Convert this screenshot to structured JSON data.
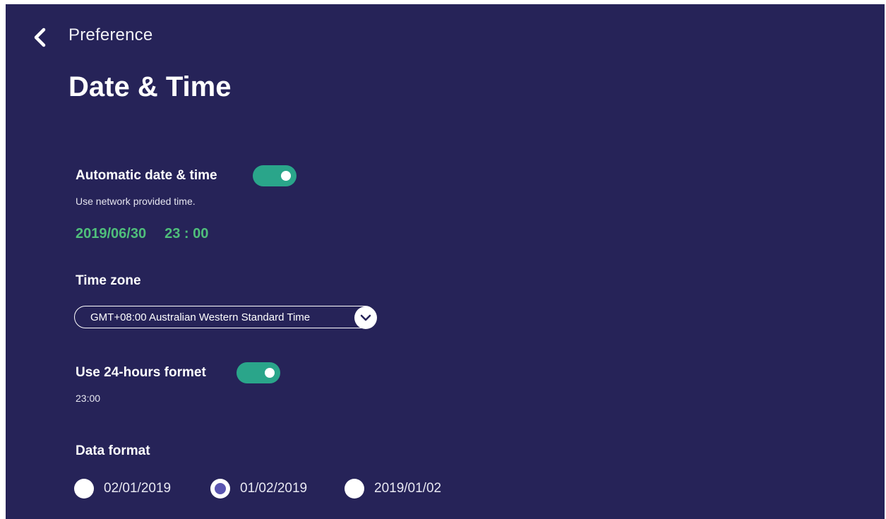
{
  "header": {
    "back_icon": "chevron-left-icon",
    "breadcrumb": "Preference",
    "title": "Date & Time"
  },
  "automatic": {
    "label": "Automatic date & time",
    "toggle_on": true,
    "description": "Use network provided time.",
    "date": "2019/06/30",
    "time": "23 : 00"
  },
  "timezone": {
    "label": "Time zone",
    "value": "GMT+08:00 Australian Western Standard Time",
    "dropdown_icon": "chevron-down-icon"
  },
  "hour_format": {
    "label": "Use 24-hours formet",
    "toggle_on": true,
    "example": "23:00"
  },
  "date_format": {
    "label": "Data format",
    "options": [
      {
        "label": "02/01/2019",
        "selected": false
      },
      {
        "label": "01/02/2019",
        "selected": true
      },
      {
        "label": "2019/01/02",
        "selected": false
      }
    ]
  },
  "colors": {
    "background": "#262358",
    "toggle_on": "#2aa58a",
    "datetime_text": "#4fbf7b",
    "radio_selected": "#5a55b0"
  }
}
